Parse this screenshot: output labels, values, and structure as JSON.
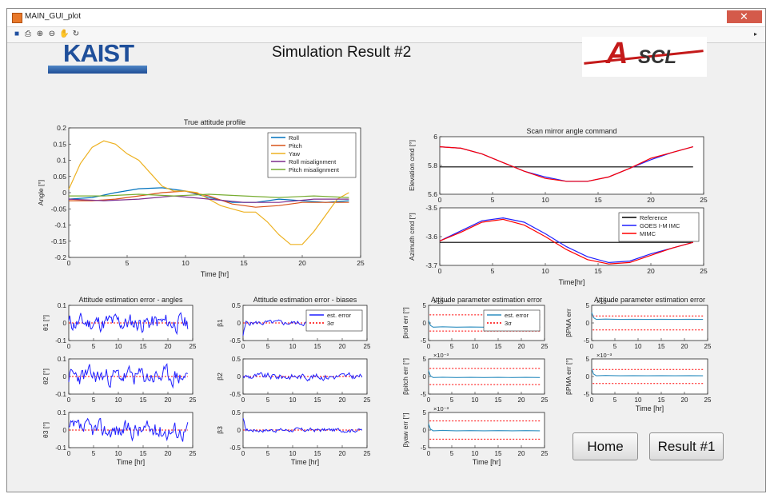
{
  "window": {
    "title": "MAIN_GUI_plot"
  },
  "toolbar": {
    "icons": [
      "save-icon",
      "print-icon",
      "zoom-in-icon",
      "zoom-out-icon",
      "pan-icon",
      "rotate-icon"
    ]
  },
  "header": {
    "title": "Simulation Result #2",
    "left_logo": "KAIST",
    "right_logo_a": "A",
    "right_logo_b": "SCL"
  },
  "buttons": {
    "home": "Home",
    "result1": "Result #1"
  },
  "colors": {
    "roll": "#0072bd",
    "pitch": "#d95319",
    "yaw": "#edb120",
    "roll_mis": "#7e2f8e",
    "pitch_mis": "#77ac30",
    "blue": "#1f1fff",
    "red": "#ff0000",
    "black": "#000000",
    "teal": "#2f8fc0"
  },
  "chart_data": [
    {
      "id": "true_attitude",
      "type": "line",
      "title": "True attitude profile",
      "xlabel": "Time [hr]",
      "ylabel": "Angle [°]",
      "xlim": [
        0,
        25
      ],
      "ylim": [
        -0.2,
        0.2
      ],
      "xticks": [
        0,
        5,
        10,
        15,
        20,
        25
      ],
      "yticks": [
        -0.2,
        -0.15,
        -0.1,
        -0.05,
        0,
        0.05,
        0.1,
        0.15,
        0.2
      ],
      "legend": "top-right",
      "series": [
        {
          "name": "Roll",
          "color": "#0072bd",
          "x": [
            0,
            2,
            4,
            6,
            8,
            10,
            12,
            14,
            16,
            18,
            20,
            22,
            24
          ],
          "y": [
            -0.02,
            -0.015,
            0.0,
            0.012,
            0.015,
            0.005,
            -0.015,
            -0.03,
            -0.03,
            -0.02,
            -0.025,
            -0.03,
            -0.025
          ]
        },
        {
          "name": "Pitch",
          "color": "#d95319",
          "x": [
            0,
            2,
            4,
            6,
            8,
            10,
            12,
            14,
            16,
            18,
            20,
            22,
            24
          ],
          "y": [
            -0.025,
            -0.025,
            -0.02,
            -0.01,
            0.0,
            0.005,
            -0.01,
            -0.035,
            -0.045,
            -0.04,
            -0.03,
            -0.03,
            -0.03
          ]
        },
        {
          "name": "Yaw",
          "color": "#edb120",
          "x": [
            0,
            1,
            2,
            3,
            4,
            5,
            6,
            7,
            8,
            9,
            10,
            11,
            12,
            13,
            14,
            15,
            16,
            17,
            18,
            19,
            20,
            21,
            22,
            23,
            24
          ],
          "y": [
            0.01,
            0.09,
            0.14,
            0.16,
            0.15,
            0.12,
            0.1,
            0.06,
            0.02,
            0.005,
            0.005,
            0.0,
            -0.02,
            -0.04,
            -0.05,
            -0.06,
            -0.06,
            -0.09,
            -0.13,
            -0.16,
            -0.16,
            -0.12,
            -0.07,
            -0.02,
            0.0
          ]
        },
        {
          "name": "Roll misalignment",
          "color": "#7e2f8e",
          "x": [
            0,
            3,
            6,
            9,
            12,
            15,
            18,
            21,
            24
          ],
          "y": [
            -0.02,
            -0.025,
            -0.02,
            -0.01,
            -0.02,
            -0.03,
            -0.03,
            -0.02,
            -0.02
          ]
        },
        {
          "name": "Pitch misalignment",
          "color": "#77ac30",
          "x": [
            0,
            3,
            6,
            9,
            12,
            15,
            18,
            21,
            24
          ],
          "y": [
            -0.01,
            -0.01,
            -0.005,
            -0.01,
            -0.005,
            -0.01,
            -0.015,
            -0.01,
            -0.015
          ]
        }
      ]
    },
    {
      "id": "elevation",
      "type": "line",
      "title": "Scan mirror angle command",
      "ylabel": "Elevation cmd [°]",
      "xlim": [
        0,
        25
      ],
      "ylim": [
        5.6,
        6.0
      ],
      "xticks": [
        0,
        5,
        10,
        15,
        20,
        25
      ],
      "yticks": [
        5.6,
        5.8,
        6
      ],
      "series": [
        {
          "name": "Reference",
          "color": "#000000",
          "x": [
            0,
            24
          ],
          "y": [
            5.79,
            5.79
          ]
        },
        {
          "name": "GOES I-M IMC",
          "color": "#1f1fff",
          "x": [
            0,
            2,
            4,
            6,
            8,
            10,
            12,
            14,
            16,
            18,
            20,
            22,
            24
          ],
          "y": [
            5.93,
            5.92,
            5.88,
            5.82,
            5.76,
            5.72,
            5.69,
            5.69,
            5.72,
            5.78,
            5.84,
            5.89,
            5.93
          ]
        },
        {
          "name": "MIMC",
          "color": "#ff0000",
          "x": [
            0,
            2,
            4,
            6,
            8,
            10,
            12,
            14,
            16,
            18,
            20,
            22,
            24
          ],
          "y": [
            5.93,
            5.92,
            5.88,
            5.82,
            5.76,
            5.71,
            5.69,
            5.69,
            5.72,
            5.78,
            5.85,
            5.89,
            5.93
          ]
        }
      ]
    },
    {
      "id": "azimuth",
      "type": "line",
      "ylabel": "Azimuth cmd [°]",
      "xlabel": "Time[hr]",
      "xlim": [
        0,
        25
      ],
      "ylim": [
        -3.7,
        -3.5
      ],
      "xticks": [
        0,
        5,
        10,
        15,
        20,
        25
      ],
      "yticks": [
        -3.7,
        -3.6,
        -3.5
      ],
      "legend": "top-right",
      "series": [
        {
          "name": "Reference",
          "color": "#000000",
          "x": [
            0,
            24
          ],
          "y": [
            -3.62,
            -3.62
          ]
        },
        {
          "name": "GOES I-M IMC",
          "color": "#1f1fff",
          "x": [
            0,
            2,
            4,
            6,
            8,
            10,
            12,
            14,
            16,
            18,
            20,
            22,
            24
          ],
          "y": [
            -3.615,
            -3.58,
            -3.545,
            -3.535,
            -3.55,
            -3.59,
            -3.635,
            -3.67,
            -3.69,
            -3.685,
            -3.66,
            -3.64,
            -3.62
          ]
        },
        {
          "name": "MIMC",
          "color": "#ff0000",
          "x": [
            0,
            2,
            4,
            6,
            8,
            10,
            12,
            14,
            16,
            18,
            20,
            22,
            24
          ],
          "y": [
            -3.615,
            -3.585,
            -3.55,
            -3.54,
            -3.56,
            -3.6,
            -3.645,
            -3.68,
            -3.695,
            -3.69,
            -3.665,
            -3.64,
            -3.62
          ]
        }
      ]
    },
    {
      "id": "theta1",
      "type": "line",
      "title": "Attitude estimation error - angles",
      "ylabel": "θ1 [°]",
      "xlim": [
        0,
        25
      ],
      "ylim": [
        -0.1,
        0.1
      ],
      "xticks": [
        0,
        5,
        10,
        15,
        20,
        25
      ],
      "yticks": [
        -0.1,
        0,
        0.1
      ],
      "noise": {
        "amp": 0.045,
        "seed": 11,
        "color": "#1f1fff"
      }
    },
    {
      "id": "theta2",
      "type": "line",
      "ylabel": "θ2 [°]",
      "xlim": [
        0,
        25
      ],
      "ylim": [
        -0.1,
        0.1
      ],
      "xticks": [
        0,
        5,
        10,
        15,
        20,
        25
      ],
      "yticks": [
        -0.1,
        0,
        0.1
      ],
      "noise": {
        "amp": 0.045,
        "seed": 23,
        "color": "#1f1fff"
      }
    },
    {
      "id": "theta3",
      "type": "line",
      "ylabel": "θ3 [°]",
      "xlabel": "Time [hr]",
      "xlim": [
        0,
        25
      ],
      "ylim": [
        -0.1,
        0.1
      ],
      "xticks": [
        0,
        5,
        10,
        15,
        20,
        25
      ],
      "yticks": [
        -0.1,
        0,
        0.1
      ],
      "noise": {
        "amp": 0.045,
        "seed": 37,
        "color": "#1f1fff"
      }
    },
    {
      "id": "beta1",
      "type": "line",
      "title": "Attitude estimation error - biases",
      "ylabel": "β1",
      "xlim": [
        0,
        25
      ],
      "ylim": [
        -0.5,
        0.5
      ],
      "xticks": [
        0,
        5,
        10,
        15,
        20,
        25
      ],
      "yticks": [
        -0.5,
        0,
        0.5
      ],
      "legend": "top-right",
      "legend_labels": [
        "est. error",
        "3σ"
      ],
      "noise": {
        "amp": 0.06,
        "seed": 5,
        "color": "#1f1fff",
        "spike": -0.35
      }
    },
    {
      "id": "beta2",
      "type": "line",
      "ylabel": "β2",
      "xlim": [
        0,
        25
      ],
      "ylim": [
        -0.5,
        0.5
      ],
      "xticks": [
        0,
        5,
        10,
        15,
        20,
        25
      ],
      "yticks": [
        -0.5,
        0,
        0.5
      ],
      "noise": {
        "amp": 0.08,
        "seed": 9,
        "color": "#1f1fff"
      }
    },
    {
      "id": "beta3",
      "type": "line",
      "ylabel": "β3",
      "xlabel": "Time [hr]",
      "xlim": [
        0,
        25
      ],
      "ylim": [
        -0.5,
        0.5
      ],
      "xticks": [
        0,
        5,
        10,
        15,
        20,
        25
      ],
      "yticks": [
        -0.5,
        0,
        0.5
      ],
      "noise": {
        "amp": 0.05,
        "seed": 17,
        "color": "#1f1fff",
        "spike": 0.3
      }
    },
    {
      "id": "beta_roll",
      "type": "line",
      "title": "Attitude parameter estimation error",
      "ylabel": "βroll err [°]",
      "xlim": [
        0,
        25
      ],
      "ylim": [
        -5,
        5
      ],
      "xticks": [
        0,
        5,
        10,
        15,
        20,
        25
      ],
      "yticks": [
        -5,
        0,
        5
      ],
      "exponent": "×10⁻³",
      "legend": "top-right",
      "legend_labels": [
        "est. error",
        "3σ"
      ],
      "param": {
        "sigma": 2.3,
        "bias": -1.2,
        "color": "#2f8fc0"
      }
    },
    {
      "id": "beta_pitch",
      "type": "line",
      "ylabel": "βpitch err [°]",
      "xlim": [
        0,
        25
      ],
      "ylim": [
        -5,
        5
      ],
      "xticks": [
        0,
        5,
        10,
        15,
        20,
        25
      ],
      "yticks": [
        -5,
        0,
        5
      ],
      "exponent": "×10⁻³",
      "param": {
        "sigma": 2.3,
        "bias": -0.3,
        "color": "#2f8fc0"
      }
    },
    {
      "id": "beta_yaw",
      "type": "line",
      "ylabel": "βyaw err [°]",
      "xlabel": "Time [hr]",
      "xlim": [
        0,
        25
      ],
      "ylim": [
        -5,
        5
      ],
      "xticks": [
        0,
        5,
        10,
        15,
        20,
        25
      ],
      "yticks": [
        -5,
        0,
        5
      ],
      "exponent": "×10⁻³",
      "param": {
        "sigma": 2.6,
        "bias": -0.2,
        "color": "#2f8fc0"
      }
    },
    {
      "id": "beta_pma1",
      "type": "line",
      "title": "Attitude parameter estimation error",
      "ylabel": "βPMA err",
      "xlim": [
        0,
        25
      ],
      "ylim": [
        -5,
        5
      ],
      "xticks": [
        0,
        5,
        10,
        15,
        20,
        25
      ],
      "yticks": [
        -5,
        0,
        5
      ],
      "exponent": "×10⁻³",
      "param": {
        "sigma": 2.0,
        "bias": 1.0,
        "color": "#2f8fc0"
      }
    },
    {
      "id": "beta_pma2",
      "type": "line",
      "ylabel": "βPMA err [°]",
      "xlabel": "Time [hr]",
      "xlim": [
        0,
        25
      ],
      "ylim": [
        -5,
        5
      ],
      "xticks": [
        0,
        5,
        10,
        15,
        20,
        25
      ],
      "yticks": [
        -5,
        0,
        5
      ],
      "exponent": "×10⁻³",
      "param": {
        "sigma": 2.0,
        "bias": 0.2,
        "color": "#2f8fc0"
      }
    }
  ]
}
